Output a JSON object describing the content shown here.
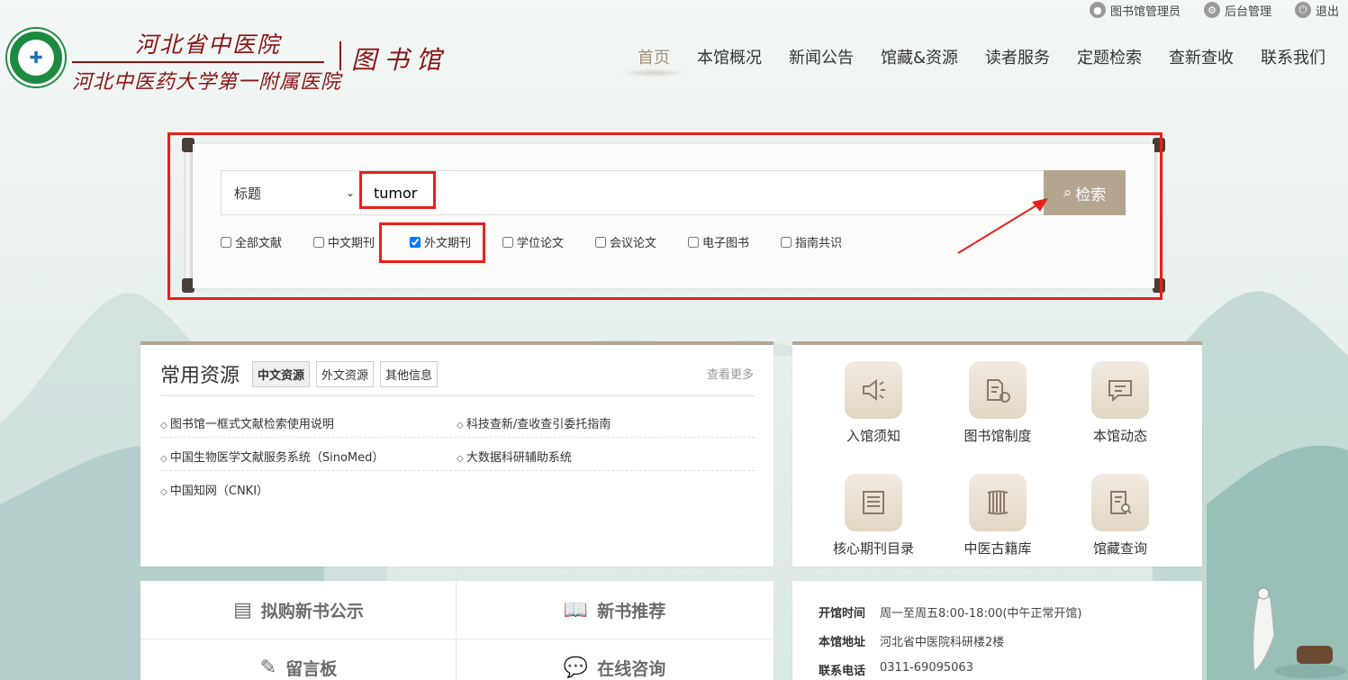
{
  "topbar": {
    "user": "图书馆管理员",
    "admin": "后台管理",
    "logout": "退出"
  },
  "header": {
    "logo_line1": "河北省中医院",
    "logo_line2": "河北中医药大学第一附属医院",
    "library": "图书馆"
  },
  "nav": [
    "首页",
    "本馆概况",
    "新闻公告",
    "馆藏&资源",
    "读者服务",
    "定题检索",
    "查新查收",
    "联系我们"
  ],
  "search": {
    "field": "标题",
    "query": "tumor",
    "button": "检索",
    "types": [
      {
        "label": "全部文献",
        "checked": false
      },
      {
        "label": "中文期刊",
        "checked": false
      },
      {
        "label": "外文期刊",
        "checked": true
      },
      {
        "label": "学位论文",
        "checked": false
      },
      {
        "label": "会议论文",
        "checked": false
      },
      {
        "label": "电子图书",
        "checked": false
      },
      {
        "label": "指南共识",
        "checked": false
      }
    ]
  },
  "resources": {
    "title": "常用资源",
    "tabs": [
      "中文资源",
      "外文资源",
      "其他信息"
    ],
    "more": "查看更多",
    "items": [
      "图书馆一框式文献检索使用说明",
      "科技查新/查收查引委托指南",
      "中国生物医学文献服务系统（SinoMed）",
      "大数据科研辅助系统",
      "中国知网（CNKI）"
    ]
  },
  "quick_access": [
    {
      "label": "入馆须知",
      "icon": "speaker-icon"
    },
    {
      "label": "图书馆制度",
      "icon": "folder-star-icon"
    },
    {
      "label": "本馆动态",
      "icon": "message-icon"
    },
    {
      "label": "核心期刊目录",
      "icon": "list-icon"
    },
    {
      "label": "中医古籍库",
      "icon": "scroll-icon"
    },
    {
      "label": "馆藏查询",
      "icon": "document-search-icon"
    }
  ],
  "bottom_links": {
    "buy": "拟购新书公示",
    "recommend": "新书推荐",
    "board": "留言板",
    "consult": "在线咨询"
  },
  "info": [
    {
      "key": "开馆时间",
      "value": "周一至周五8:00-18:00(中午正常开馆)"
    },
    {
      "key": "本馆地址",
      "value": "河北省中医院科研楼2楼"
    },
    {
      "key": "联系电话",
      "value": "0311-69095063"
    }
  ],
  "colors": {
    "accent": "#b3a590",
    "brand": "#8a1414",
    "highlight": "#e8201c"
  }
}
